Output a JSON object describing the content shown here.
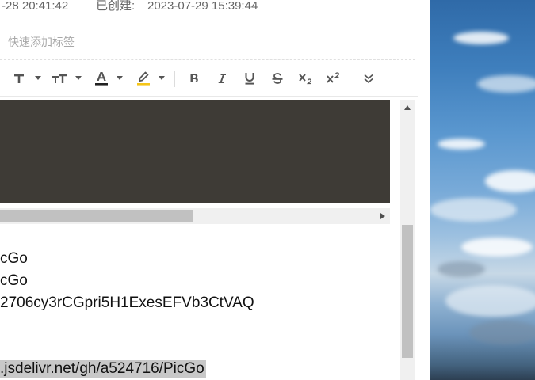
{
  "meta": {
    "modified_time": "-28 20:41:42",
    "created_label": "已创建:",
    "created_time": "2023-07-29 15:39:44"
  },
  "tags": {
    "placeholder": "快速添加标签"
  },
  "toolbar": {
    "buttons": [
      {
        "name": "font-family",
        "icon": "text-T-icon"
      },
      {
        "name": "font-size",
        "icon": "text-size-icon"
      },
      {
        "name": "font-color",
        "icon": "font-color-icon",
        "color": "#222222"
      },
      {
        "name": "highlight",
        "icon": "highlighter-icon",
        "color": "#f5c518"
      },
      {
        "name": "bold",
        "icon": "bold-icon"
      },
      {
        "name": "italic",
        "icon": "italic-icon"
      },
      {
        "name": "underline",
        "icon": "underline-icon"
      },
      {
        "name": "strikethrough",
        "icon": "strikethrough-icon"
      },
      {
        "name": "subscript",
        "icon": "subscript-icon"
      },
      {
        "name": "superscript",
        "icon": "superscript-icon"
      },
      {
        "name": "more",
        "icon": "double-chevron-down-icon"
      }
    ]
  },
  "content": {
    "code_block_color": "#3e3b36",
    "lines": [
      "cGo",
      "cGo",
      "2706cy3rCGpri5H1ExesEFVb3CtVAQ",
      ".jsdelivr.net/gh/a524716/PicGo"
    ]
  }
}
